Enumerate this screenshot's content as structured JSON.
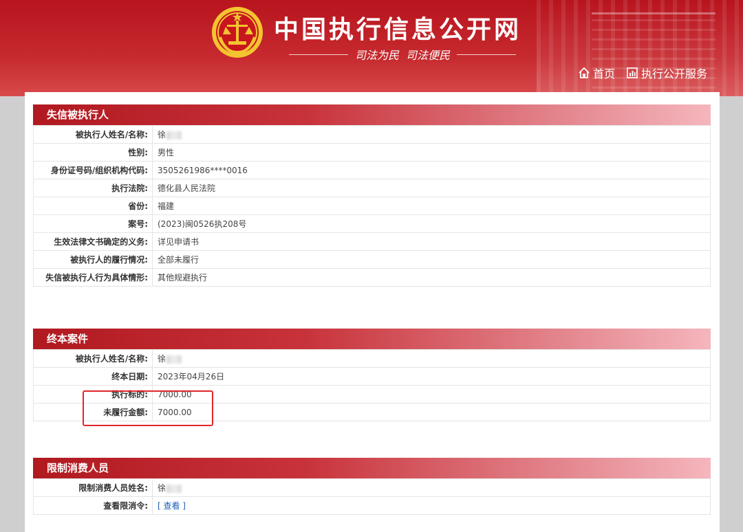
{
  "header": {
    "site_title": "中国执行信息公开网",
    "slogan_left": "司法为民",
    "slogan_right": "司法便民",
    "nav": [
      {
        "label": "首页",
        "icon": "home-icon"
      },
      {
        "label": "执行公开服务",
        "icon": "chart-box-icon"
      }
    ]
  },
  "panels": {
    "dishonest": {
      "title": "失信被执行人",
      "rows": [
        {
          "label": "被执行人姓名/名称:",
          "value": "徐"
        },
        {
          "label": "性别:",
          "value": "男性"
        },
        {
          "label": "身份证号码/组织机构代码:",
          "value": "3505261986****0016"
        },
        {
          "label": "执行法院:",
          "value": "德化县人民法院"
        },
        {
          "label": "省份:",
          "value": "福建"
        },
        {
          "label": "案号:",
          "value": "(2023)闽0526执208号"
        },
        {
          "label": "生效法律文书确定的义务:",
          "value": "详见申请书"
        },
        {
          "label": "被执行人的履行情况:",
          "value": "全部未履行"
        },
        {
          "label": "失信被执行人行为具体情形:",
          "value": "其他规避执行"
        }
      ]
    },
    "terminated": {
      "title": "终本案件",
      "rows": [
        {
          "label": "被执行人姓名/名称:",
          "value": "徐"
        },
        {
          "label": "终本日期:",
          "value": "2023年04月26日"
        },
        {
          "label": "执行标的:",
          "value": "7000.00"
        },
        {
          "label": "未履行金额:",
          "value": "7000.00"
        }
      ]
    },
    "restricted": {
      "title": "限制消费人员",
      "rows": [
        {
          "label": "限制消费人员姓名:",
          "value": "徐"
        },
        {
          "label": "查看限消令:",
          "value": "[ 查看 ]"
        }
      ]
    }
  },
  "colors": {
    "header_red": "#b8141e",
    "highlight_box": "#e0262c",
    "link": "#1a5fb4"
  }
}
